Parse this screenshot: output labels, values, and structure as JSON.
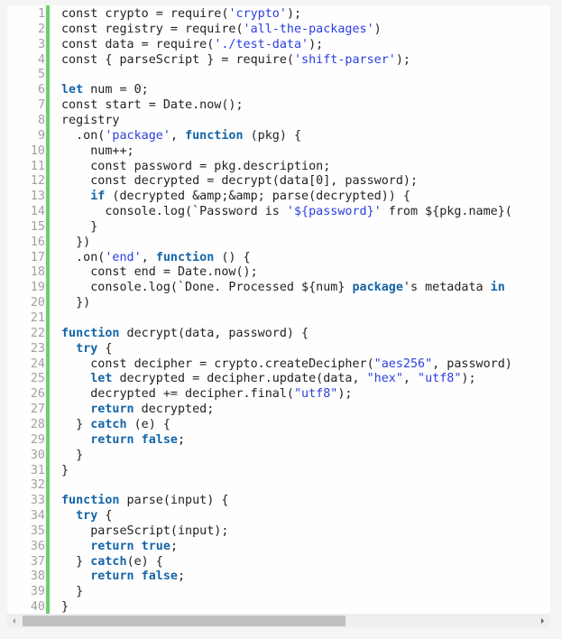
{
  "editor": {
    "language": "javascript",
    "colors": {
      "keyword": "#1565a8",
      "string": "#2a3ee0",
      "text": "#222222",
      "line_number": "#a0a0a0",
      "gutter_marker": "#6ccf6a"
    },
    "lines": [
      {
        "n": "1",
        "tokens": [
          [
            "t",
            "const crypto = require("
          ],
          [
            "s",
            "'crypto'"
          ],
          [
            "t",
            ");"
          ]
        ]
      },
      {
        "n": "2",
        "tokens": [
          [
            "t",
            "const registry = require("
          ],
          [
            "s",
            "'all-the-packages'"
          ],
          [
            "t",
            ")"
          ]
        ]
      },
      {
        "n": "3",
        "tokens": [
          [
            "t",
            "const data = require("
          ],
          [
            "s",
            "'./test-data'"
          ],
          [
            "t",
            ");"
          ]
        ]
      },
      {
        "n": "4",
        "tokens": [
          [
            "t",
            "const { parseScript } = require("
          ],
          [
            "s",
            "'shift-parser'"
          ],
          [
            "t",
            ");"
          ]
        ]
      },
      {
        "n": "5",
        "tokens": []
      },
      {
        "n": "6",
        "tokens": [
          [
            "k",
            "let"
          ],
          [
            "t",
            " num = 0;"
          ]
        ]
      },
      {
        "n": "7",
        "tokens": [
          [
            "t",
            "const start = Date.now();"
          ]
        ]
      },
      {
        "n": "8",
        "tokens": [
          [
            "t",
            "registry"
          ]
        ]
      },
      {
        "n": "9",
        "tokens": [
          [
            "t",
            "  .on("
          ],
          [
            "s",
            "'package'"
          ],
          [
            "t",
            ", "
          ],
          [
            "k",
            "function"
          ],
          [
            "t",
            " (pkg) {"
          ]
        ]
      },
      {
        "n": "10",
        "tokens": [
          [
            "t",
            "    num++;"
          ]
        ]
      },
      {
        "n": "11",
        "tokens": [
          [
            "t",
            "    const password = pkg.description;"
          ]
        ]
      },
      {
        "n": "12",
        "tokens": [
          [
            "t",
            "    const decrypted = decrypt(data[0], password);"
          ]
        ]
      },
      {
        "n": "13",
        "tokens": [
          [
            "t",
            "    "
          ],
          [
            "k",
            "if"
          ],
          [
            "t",
            " (decrypted &amp;&amp; parse(decrypted)) {"
          ]
        ]
      },
      {
        "n": "14",
        "tokens": [
          [
            "t",
            "      console.log(`Password is "
          ],
          [
            "s",
            "'${password}'"
          ],
          [
            "t",
            " from ${pkg.name}("
          ]
        ]
      },
      {
        "n": "15",
        "tokens": [
          [
            "t",
            "    }"
          ]
        ]
      },
      {
        "n": "16",
        "tokens": [
          [
            "t",
            "  })"
          ]
        ]
      },
      {
        "n": "17",
        "tokens": [
          [
            "t",
            "  .on("
          ],
          [
            "s",
            "'end'"
          ],
          [
            "t",
            ", "
          ],
          [
            "k",
            "function"
          ],
          [
            "t",
            " () {"
          ]
        ]
      },
      {
        "n": "18",
        "tokens": [
          [
            "t",
            "    const end = Date.now();"
          ]
        ]
      },
      {
        "n": "19",
        "tokens": [
          [
            "t",
            "    console.log(`Done. Processed ${num} "
          ],
          [
            "k",
            "package"
          ],
          [
            "t",
            "'s metadata "
          ],
          [
            "k",
            "in"
          ]
        ]
      },
      {
        "n": "20",
        "tokens": [
          [
            "t",
            "  })"
          ]
        ]
      },
      {
        "n": "21",
        "tokens": []
      },
      {
        "n": "22",
        "tokens": [
          [
            "k",
            "function"
          ],
          [
            "t",
            " decrypt(data, password) {"
          ]
        ]
      },
      {
        "n": "23",
        "tokens": [
          [
            "t",
            "  "
          ],
          [
            "k",
            "try"
          ],
          [
            "t",
            " {"
          ]
        ]
      },
      {
        "n": "24",
        "tokens": [
          [
            "t",
            "    const decipher = crypto.createDecipher("
          ],
          [
            "s",
            "\"aes256\""
          ],
          [
            "t",
            ", password)"
          ]
        ]
      },
      {
        "n": "25",
        "tokens": [
          [
            "t",
            "    "
          ],
          [
            "k",
            "let"
          ],
          [
            "t",
            " decrypted = decipher.update(data, "
          ],
          [
            "s",
            "\"hex\""
          ],
          [
            "t",
            ", "
          ],
          [
            "s",
            "\"utf8\""
          ],
          [
            "t",
            ");"
          ]
        ]
      },
      {
        "n": "26",
        "tokens": [
          [
            "t",
            "    decrypted += decipher.final("
          ],
          [
            "s",
            "\"utf8\""
          ],
          [
            "t",
            ");"
          ]
        ]
      },
      {
        "n": "27",
        "tokens": [
          [
            "t",
            "    "
          ],
          [
            "k",
            "return"
          ],
          [
            "t",
            " decrypted;"
          ]
        ]
      },
      {
        "n": "28",
        "tokens": [
          [
            "t",
            "  } "
          ],
          [
            "k",
            "catch"
          ],
          [
            "t",
            " (e) {"
          ]
        ]
      },
      {
        "n": "29",
        "tokens": [
          [
            "t",
            "    "
          ],
          [
            "k",
            "return false"
          ],
          [
            "t",
            ";"
          ]
        ]
      },
      {
        "n": "30",
        "tokens": [
          [
            "t",
            "  }"
          ]
        ]
      },
      {
        "n": "31",
        "tokens": [
          [
            "t",
            "}"
          ]
        ]
      },
      {
        "n": "32",
        "tokens": []
      },
      {
        "n": "33",
        "tokens": [
          [
            "k",
            "function"
          ],
          [
            "t",
            " parse(input) {"
          ]
        ]
      },
      {
        "n": "34",
        "tokens": [
          [
            "t",
            "  "
          ],
          [
            "k",
            "try"
          ],
          [
            "t",
            " {"
          ]
        ]
      },
      {
        "n": "35",
        "tokens": [
          [
            "t",
            "    parseScript(input);"
          ]
        ]
      },
      {
        "n": "36",
        "tokens": [
          [
            "t",
            "    "
          ],
          [
            "k",
            "return true"
          ],
          [
            "t",
            ";"
          ]
        ]
      },
      {
        "n": "37",
        "tokens": [
          [
            "t",
            "  } "
          ],
          [
            "k",
            "catch"
          ],
          [
            "t",
            "(e) {"
          ]
        ]
      },
      {
        "n": "38",
        "tokens": [
          [
            "t",
            "    "
          ],
          [
            "k",
            "return false"
          ],
          [
            "t",
            ";"
          ]
        ]
      },
      {
        "n": "39",
        "tokens": [
          [
            "t",
            "  }"
          ]
        ]
      },
      {
        "n": "40",
        "tokens": [
          [
            "t",
            "}"
          ]
        ]
      }
    ]
  },
  "scrollbar": {
    "horizontal_visible_fraction": 0.63,
    "horizontal_position": 0,
    "left_arrow_icon": "arrow-left-icon",
    "right_arrow_icon": "arrow-right-icon"
  }
}
